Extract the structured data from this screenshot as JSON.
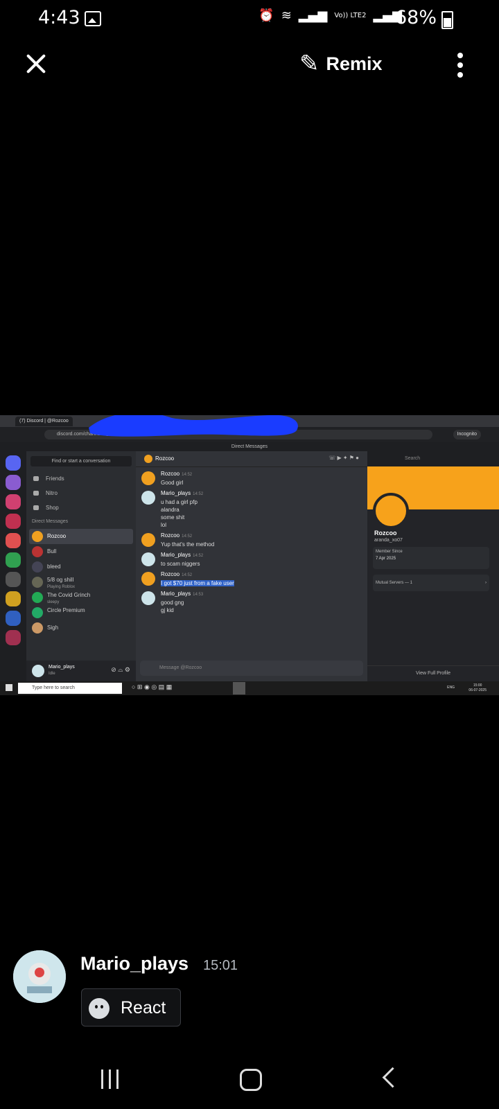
{
  "status_bar": {
    "time": "4:43",
    "net": "Vo)) LTE2",
    "battery": "68%"
  },
  "top_bar": {
    "remix_label": "Remix"
  },
  "screenshot": {
    "browser_tab": "(7) Discord | @Rozcoo",
    "url": "discord.com/channels/@me/1363701983189273558",
    "incognito_label": "Incognito",
    "window_title": "Direct Messages",
    "sidebar": {
      "find_placeholder": "Find or start a conversation",
      "nav": [
        "Friends",
        "Nitro",
        "Shop"
      ],
      "dm_header": "Direct Messages",
      "dms": [
        {
          "name": "Rozcoo",
          "sub": ""
        },
        {
          "name": "Bull",
          "sub": ""
        },
        {
          "name": "bleed",
          "sub": ""
        },
        {
          "name": "5/8 og shill",
          "sub": "Playing Roblox"
        },
        {
          "name": "The Covid Grinch",
          "sub": "sleepy"
        },
        {
          "name": "Circle Premium",
          "sub": ""
        },
        {
          "name": "Sigh",
          "sub": ""
        }
      ],
      "user_name": "Mario_plays",
      "user_status": "Idle"
    },
    "chat": {
      "channel_name": "Rozcoo",
      "search_placeholder": "Search",
      "messages": [
        {
          "author": "Rozcoo",
          "time": "14:52",
          "lines": [
            "Good girl"
          ]
        },
        {
          "author": "Mario_plays",
          "time": "14:52",
          "lines": [
            "u had a girl pfp",
            "alandra",
            "some shit",
            "lol"
          ]
        },
        {
          "author": "Rozcoo",
          "time": "14:52",
          "lines": [
            "Yup that's the method"
          ]
        },
        {
          "author": "Mario_plays",
          "time": "14:52",
          "lines": [
            "to scam niggers"
          ]
        },
        {
          "author": "Rozcoo",
          "time": "14:52",
          "lines": [
            "I got $70 just from a fake user"
          ]
        },
        {
          "author": "Mario_plays",
          "time": "14:53",
          "lines": [
            "good gng",
            "gj kid"
          ]
        }
      ],
      "composer_placeholder": "Message @Rozcoo"
    },
    "profile": {
      "name": "Rozcoo",
      "username": "aranda_xo07",
      "member_since_label": "Member Since",
      "member_since": "7 Apr 2025",
      "mutual_servers": "Mutual Servers — 1",
      "view_full": "View Full Profile"
    },
    "taskbar": {
      "search_placeholder": "Type here to search",
      "lang": "ENG",
      "clock_time": "15:00",
      "clock_date": "06-07-2025"
    }
  },
  "post": {
    "author": "Mario_plays",
    "time": "15:01",
    "react_label": "React"
  },
  "colors": {
    "accent": "#f7a21b",
    "discord_blurple": "#5865f2",
    "scribble": "#1a3cff"
  }
}
